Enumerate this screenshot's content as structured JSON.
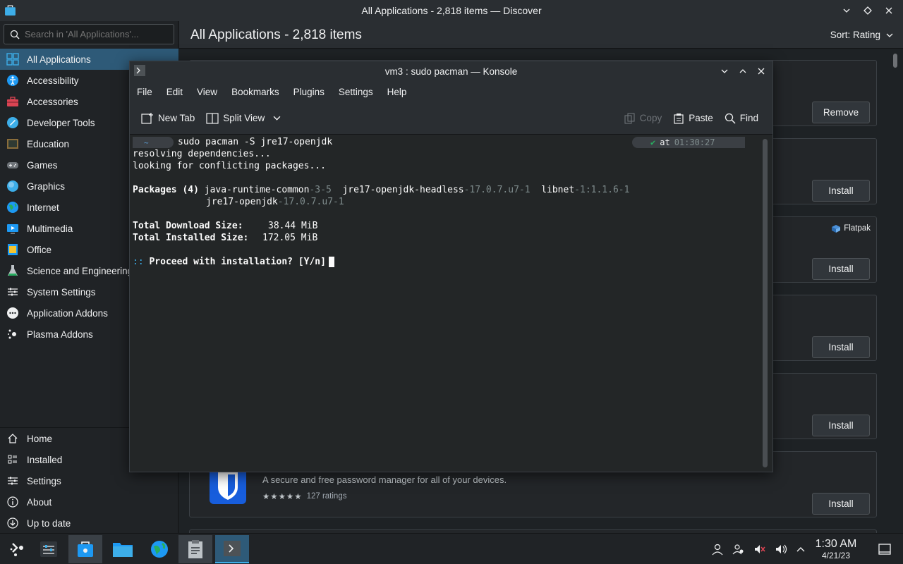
{
  "window": {
    "title": "All Applications - 2,818 items — Discover"
  },
  "search": {
    "placeholder": "Search in 'All Applications'..."
  },
  "sidebar": {
    "categories": [
      {
        "label": "All Applications"
      },
      {
        "label": "Accessibility"
      },
      {
        "label": "Accessories"
      },
      {
        "label": "Developer Tools"
      },
      {
        "label": "Education"
      },
      {
        "label": "Games"
      },
      {
        "label": "Graphics"
      },
      {
        "label": "Internet"
      },
      {
        "label": "Multimedia"
      },
      {
        "label": "Office"
      },
      {
        "label": "Science and Engineering"
      },
      {
        "label": "System Settings"
      },
      {
        "label": "Application Addons"
      },
      {
        "label": "Plasma Addons"
      }
    ],
    "bottom": [
      {
        "label": "Home"
      },
      {
        "label": "Installed"
      },
      {
        "label": "Settings"
      },
      {
        "label": "About"
      },
      {
        "label": "Up to date"
      }
    ]
  },
  "main": {
    "heading": "All Applications - 2,818 items",
    "sort_label": "Sort: Rating",
    "remove_label": "Remove",
    "install_label": "Install",
    "flatpak_label": "Flatpak",
    "bitwarden_desc": "A secure and free password manager for all of your devices.",
    "bitwarden_ratings": "127 ratings"
  },
  "konsole": {
    "title": "vm3 : sudo pacman — Konsole",
    "menu": [
      "File",
      "Edit",
      "View",
      "Bookmarks",
      "Plugins",
      "Settings",
      "Help"
    ],
    "toolbar": {
      "new_tab": "New Tab",
      "split_view": "Split View",
      "copy": "Copy",
      "paste": "Paste",
      "find": "Find"
    },
    "terminal": {
      "dir": "~",
      "command": "sudo pacman -S jre17-openjdk",
      "at": "at",
      "time": "01:30:27",
      "line_resolving": "resolving dependencies...",
      "line_looking": "looking for conflicting packages...",
      "packages_label": "Packages (4)",
      "pkg1_name": "java-runtime-common",
      "pkg1_ver": "-3-5",
      "pkg2_name": "jre17-openjdk-headless",
      "pkg2_ver": "-17.0.7.u7-1",
      "pkg3_name": "libnet",
      "pkg3_ver": "-1:1.1.6-1",
      "pkg4_name": "jre17-openjdk",
      "pkg4_ver": "-17.0.7.u7-1",
      "download_label": "Total Download Size:",
      "download_value": "38.44 MiB",
      "installed_label": "Total Installed Size:",
      "installed_value": "172.05 MiB",
      "proceed_prefix": "::",
      "proceed_text": "Proceed with installation? [Y/n]"
    }
  },
  "taskbar": {
    "time": "1:30 AM",
    "date": "4/21/23"
  },
  "colors": {
    "accent": "#3daee9",
    "selection": "#2e5a78",
    "window_bg": "#2a2e32"
  }
}
